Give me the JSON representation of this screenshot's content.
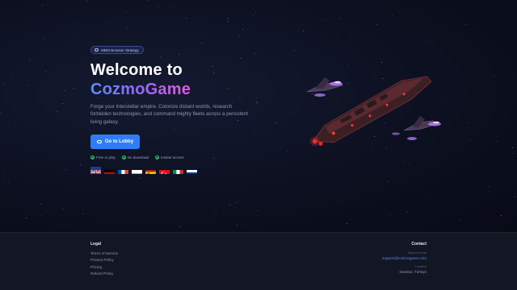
{
  "hero": {
    "badge": "MMO Browser Strategy",
    "title_line1": "Welcome to",
    "title_line2": "CozmoGame",
    "description": "Forge your interstellar empire. Colonize distant worlds, research forbidden technologies, and command mighty fleets across a persistent living galaxy.",
    "cta_label": "Go to Lobby",
    "perks": [
      "Free to play",
      "No download",
      "Instant access"
    ],
    "languages": [
      "English",
      "German",
      "French",
      "Polish",
      "Spanish",
      "Turkish",
      "Italian",
      "Russian"
    ]
  },
  "footer": {
    "legal_title": "Legal",
    "legal_links": [
      "Terms of Service",
      "Privacy Policy",
      "Pricing",
      "Refund Policy"
    ],
    "contact_title": "Contact",
    "support_label": "Support email",
    "support_email": "support@cozmogame.com",
    "location_label": "Location",
    "location": "Istanbul, Türkiye"
  },
  "colors": {
    "accent": "#2f7df6",
    "gradient_start": "#5b8cff",
    "gradient_end": "#e35ad8",
    "check": "#30c86a"
  }
}
